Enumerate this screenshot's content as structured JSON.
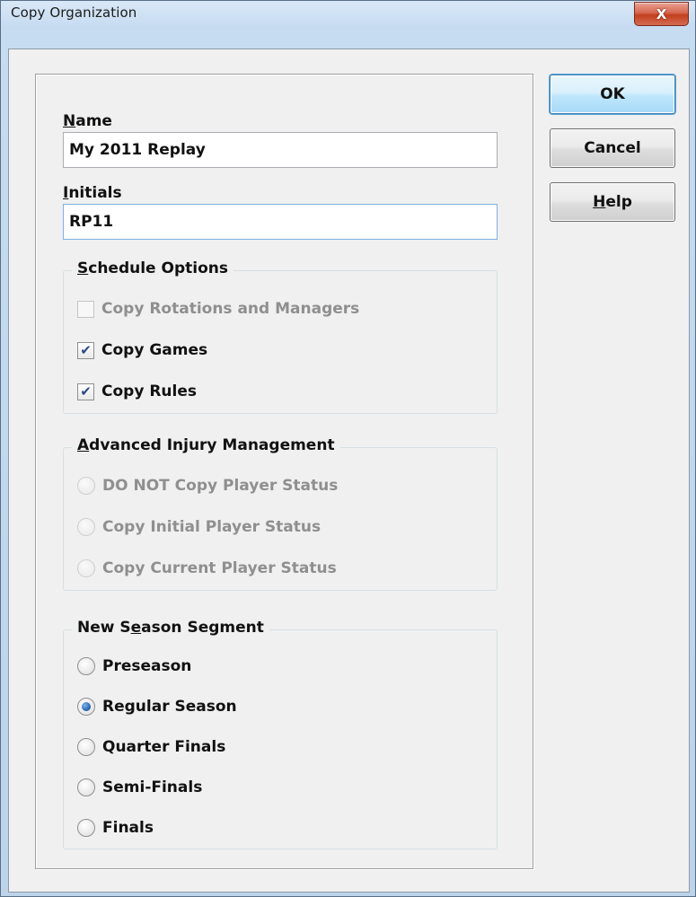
{
  "window": {
    "title": "Copy Organization",
    "close_label": "X"
  },
  "fields": {
    "name_label_underline": "N",
    "name_label_rest": "ame",
    "name_value": "My 2011 Replay",
    "initials_label_underline": "I",
    "initials_label_rest": "nitials",
    "initials_value": "RP11"
  },
  "schedule": {
    "title_underline": "S",
    "title_rest": "chedule Options",
    "options": [
      {
        "label": "Copy Rotations and Managers",
        "checked": false,
        "enabled": false
      },
      {
        "label": "Copy Games",
        "checked": true,
        "enabled": true
      },
      {
        "label": "Copy Rules",
        "checked": true,
        "enabled": true
      }
    ]
  },
  "injury": {
    "title_underline": "A",
    "title_rest": "dvanced Injury Management",
    "options": [
      {
        "label": "DO NOT Copy Player Status",
        "selected": false,
        "enabled": false
      },
      {
        "label": "Copy Initial Player Status",
        "selected": false,
        "enabled": false
      },
      {
        "label": "Copy Current Player Status",
        "selected": false,
        "enabled": false
      }
    ]
  },
  "segment": {
    "title_pre": "New S",
    "title_underline": "e",
    "title_rest": "ason Segment",
    "options": [
      {
        "label": "Preseason",
        "selected": false
      },
      {
        "label": "Regular Season",
        "selected": true
      },
      {
        "label": "Quarter Finals",
        "selected": false
      },
      {
        "label": "Semi-Finals",
        "selected": false
      },
      {
        "label": "Finals",
        "selected": false
      }
    ]
  },
  "buttons": {
    "ok": "OK",
    "cancel": "Cancel",
    "help_underline": "H",
    "help_rest": "elp"
  },
  "icons": {
    "check": "✔",
    "close": "close-icon"
  }
}
